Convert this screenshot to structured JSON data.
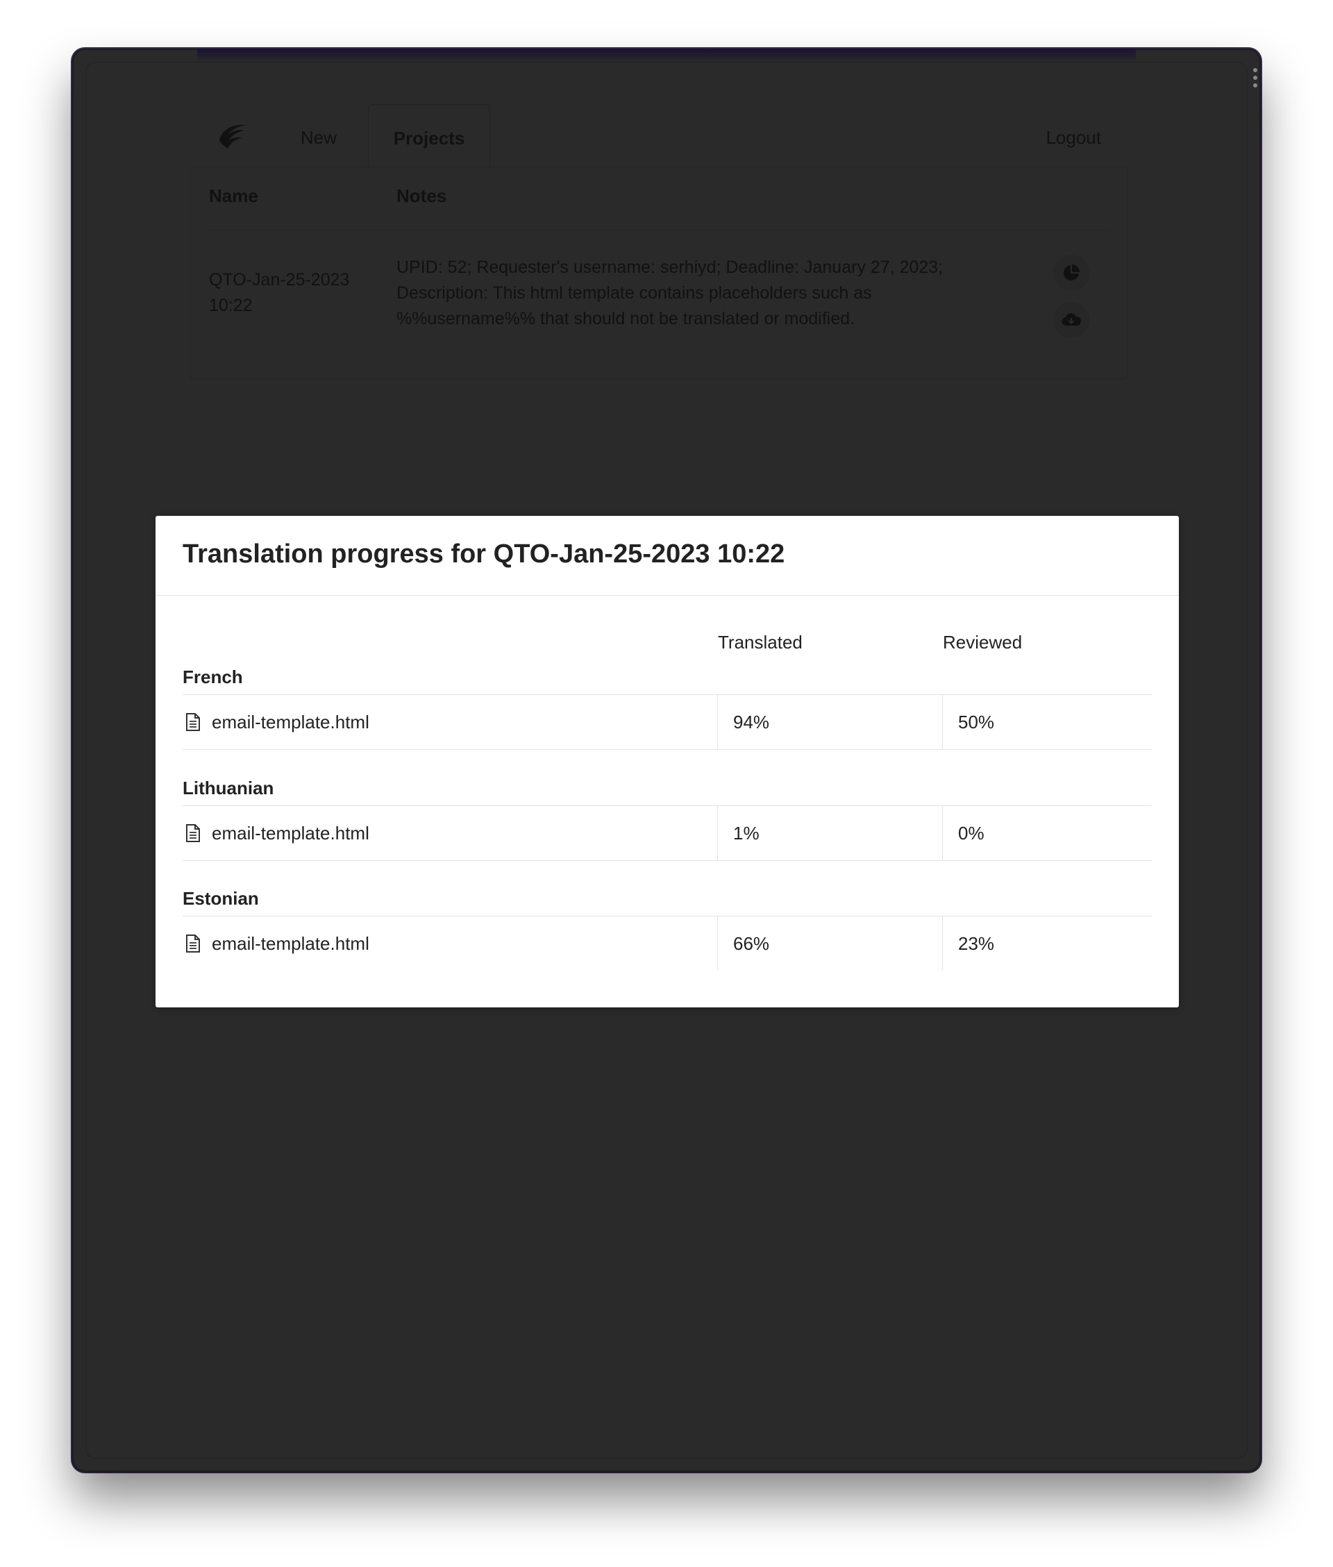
{
  "nav": {
    "logo_icon": "falcon-logo-icon",
    "tabs": [
      {
        "label": "New",
        "active": false
      },
      {
        "label": "Projects",
        "active": true
      }
    ],
    "logout_label": "Logout"
  },
  "projects": {
    "columns": [
      "Name",
      "Notes"
    ],
    "rows": [
      {
        "name": "QTO-Jan-25-2023 10:22",
        "notes": "UPID: 52; Requester's username: serhiyd; Deadline: January 27, 2023; Description: This html template contains placeholders such as %%username%% that should not be translated or modified.",
        "actions": [
          "pie-chart-icon",
          "cloud-download-icon"
        ]
      }
    ]
  },
  "modal": {
    "title": "Translation progress for QTO-Jan-25-2023 10:22",
    "columns": {
      "translated": "Translated",
      "reviewed": "Reviewed"
    },
    "languages": [
      {
        "name": "French",
        "files": [
          {
            "file": "email-template.html",
            "translated": "94%",
            "reviewed": "50%"
          }
        ]
      },
      {
        "name": "Lithuanian",
        "files": [
          {
            "file": "email-template.html",
            "translated": "1%",
            "reviewed": "0%"
          }
        ]
      },
      {
        "name": "Estonian",
        "files": [
          {
            "file": "email-template.html",
            "translated": "66%",
            "reviewed": "23%"
          }
        ]
      }
    ]
  },
  "colors": {
    "overlay_background": "#2a2a2a",
    "modal_background": "#ffffff",
    "text": "#222222",
    "divider": "#e3e3e3"
  }
}
